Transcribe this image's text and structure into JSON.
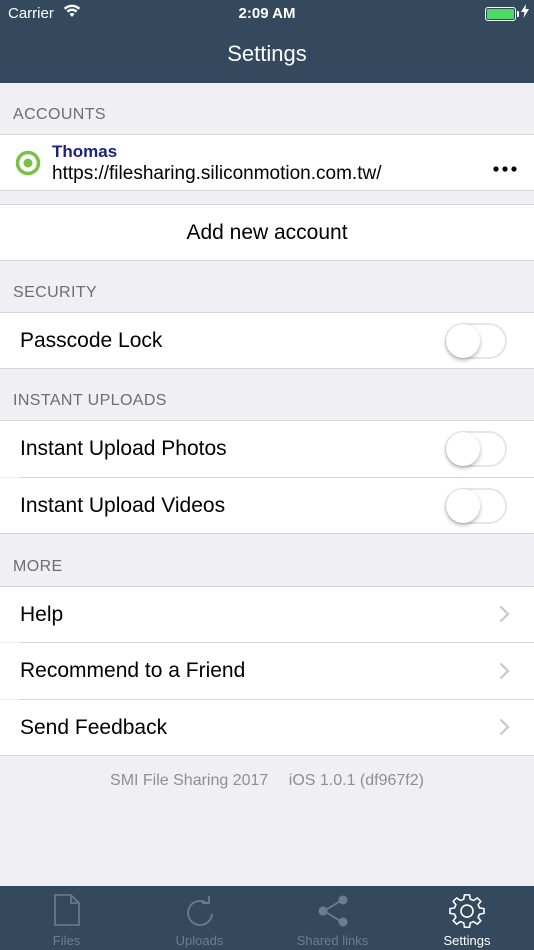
{
  "status_bar": {
    "carrier": "Carrier",
    "time": "2:09 AM"
  },
  "nav": {
    "title": "Settings"
  },
  "sections": {
    "accounts": "ACCOUNTS",
    "security": "SECURITY",
    "instant_uploads": "INSTANT UPLOADS",
    "more": "MORE"
  },
  "account": {
    "name": "Thomas",
    "url": "https://filesharing.siliconmotion.com.tw/",
    "status_color": "#7ac143"
  },
  "add_account": {
    "label": "Add new account"
  },
  "security": {
    "passcode_label": "Passcode Lock",
    "passcode_on": false
  },
  "instant_uploads": {
    "photos_label": "Instant Upload Photos",
    "photos_on": false,
    "videos_label": "Instant Upload Videos",
    "videos_on": false
  },
  "more": {
    "help": "Help",
    "recommend": "Recommend to a Friend",
    "feedback": "Send Feedback"
  },
  "footer": {
    "app": "SMI File Sharing 2017",
    "version": "iOS 1.0.1 (df967f2)"
  },
  "tabs": [
    {
      "label": "Files",
      "icon": "file-icon"
    },
    {
      "label": "Uploads",
      "icon": "refresh-icon"
    },
    {
      "label": "Shared links",
      "icon": "share-icon"
    },
    {
      "label": "Settings",
      "icon": "gear-icon"
    }
  ],
  "colors": {
    "nav_bg": "#34495e",
    "account_name": "#1a237e",
    "battery": "#4cd964"
  }
}
